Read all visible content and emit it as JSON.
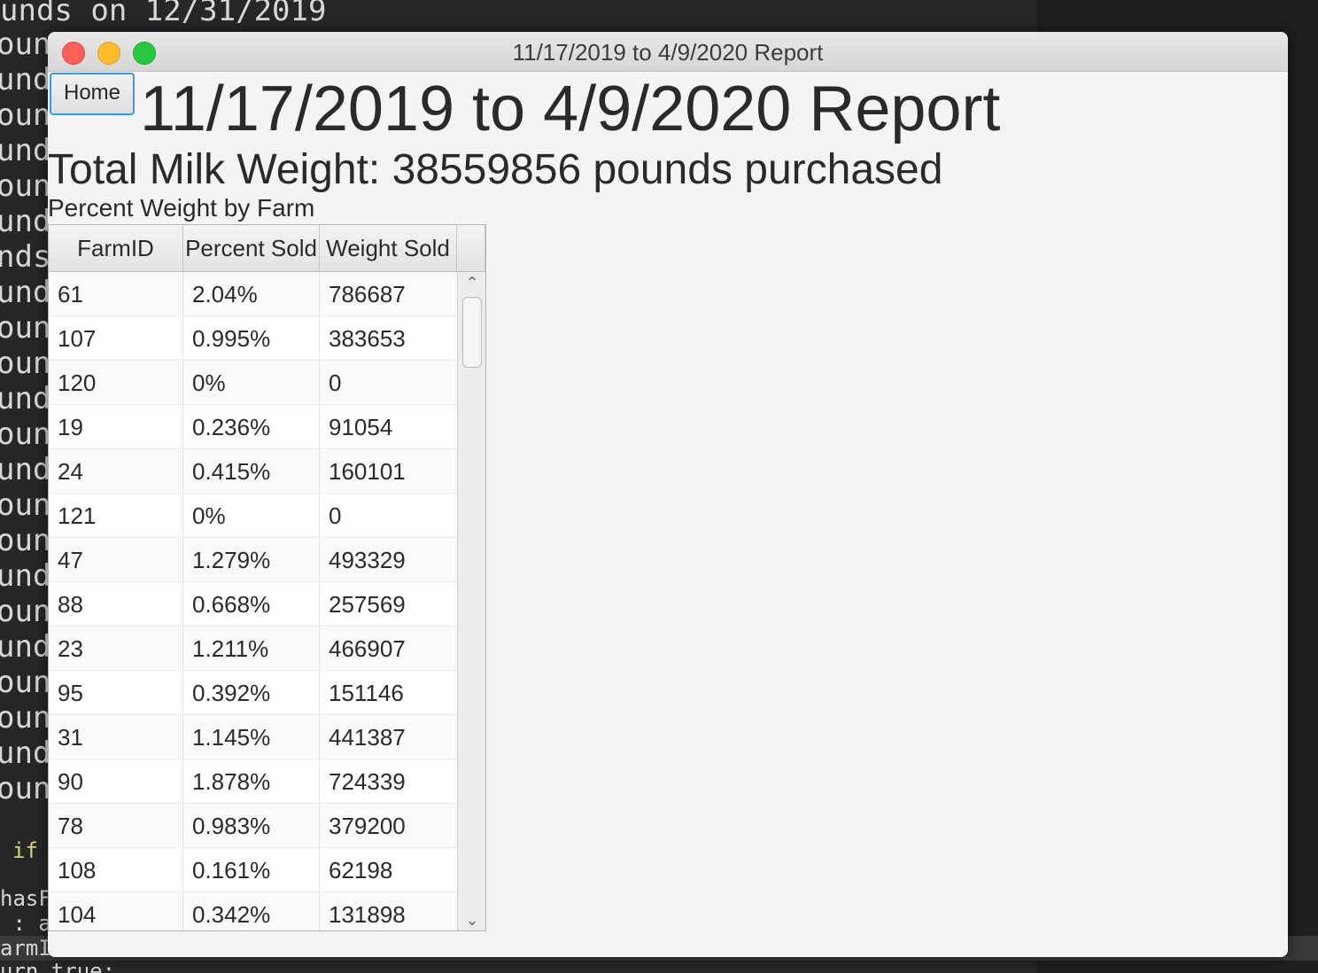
{
  "terminal": {
    "top_line": "unds on 12/31/2019",
    "side_fragments": [
      "oun",
      "und",
      "oun",
      "und",
      "oun",
      "und",
      "nds",
      "und",
      "oun",
      "oun",
      "und",
      "oun",
      "und",
      "oun",
      "oun",
      "und",
      "oun",
      "und",
      "oun",
      "oun",
      "und",
      "oun"
    ],
    "bottom_lines": [
      "if",
      "hasF",
      " : a",
      "armI",
      "urn true;"
    ]
  },
  "window": {
    "title": "11/17/2019 to 4/9/2020 Report"
  },
  "page": {
    "home_button_label": "Home",
    "report_title": "11/17/2019 to 4/9/2020 Report",
    "total_weight_text": "Total Milk Weight: 38559856 pounds purchased",
    "section_label": "Percent Weight by Farm"
  },
  "table": {
    "columns": [
      "FarmID",
      "Percent Sold",
      "Weight Sold"
    ],
    "rows": [
      [
        "61",
        "2.04%",
        "786687"
      ],
      [
        "107",
        "0.995%",
        "383653"
      ],
      [
        "120",
        "0%",
        "0"
      ],
      [
        "19",
        "0.236%",
        "91054"
      ],
      [
        "24",
        "0.415%",
        "160101"
      ],
      [
        "121",
        "0%",
        "0"
      ],
      [
        "47",
        "1.279%",
        "493329"
      ],
      [
        "88",
        "0.668%",
        "257569"
      ],
      [
        "23",
        "1.211%",
        "466907"
      ],
      [
        "95",
        "0.392%",
        "151146"
      ],
      [
        "31",
        "1.145%",
        "441387"
      ],
      [
        "90",
        "1.878%",
        "724339"
      ],
      [
        "78",
        "0.983%",
        "379200"
      ],
      [
        "108",
        "0.161%",
        "62198"
      ],
      [
        "104",
        "0.342%",
        "131898"
      ]
    ]
  },
  "icons": {
    "scroll_up": "chevron-up-icon",
    "scroll_down": "chevron-down-icon"
  },
  "colors": {
    "close": "#fc5f57",
    "minimize": "#fdbc2e",
    "maximize": "#28c840",
    "focus_ring": "#3c9ad8"
  }
}
